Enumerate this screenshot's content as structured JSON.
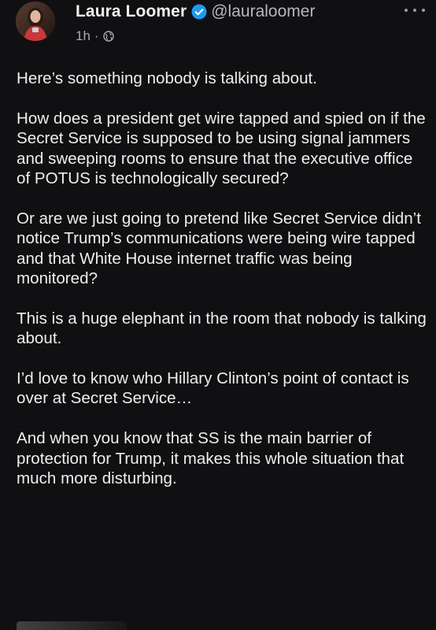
{
  "post": {
    "author": {
      "display_name": "Laura Loomer",
      "handle": "@lauraloomer",
      "verified": true,
      "avatar_icon": "profile-photo"
    },
    "meta": {
      "time": "1h",
      "separator": "·",
      "audience_icon": "globe-icon"
    },
    "more_icon": "ellipsis-icon",
    "paragraphs": [
      "Here’s something nobody is talking about.",
      "How does a president get wire tapped and spied on if the Secret Service is supposed to be using signal jammers and sweeping rooms to ensure that the executive office of POTUS is technologically secured?",
      "Or are we just going to pretend like Secret Service didn’t notice Trump’s communications were being wire tapped and that White House internet traffic was being monitored?",
      "This is a huge elephant in the room that nobody is talking about.",
      "I’d love to know who Hillary Clinton’s point of contact is over at Secret Service…",
      "And when you know that SS is the main barrier of protection for Trump, it makes this whole situation that much more disturbing."
    ]
  },
  "colors": {
    "background": "#101012",
    "text": "#eeeeee",
    "secondary_text": "#a9a9ae",
    "verified_badge": "#1d9bf0"
  }
}
